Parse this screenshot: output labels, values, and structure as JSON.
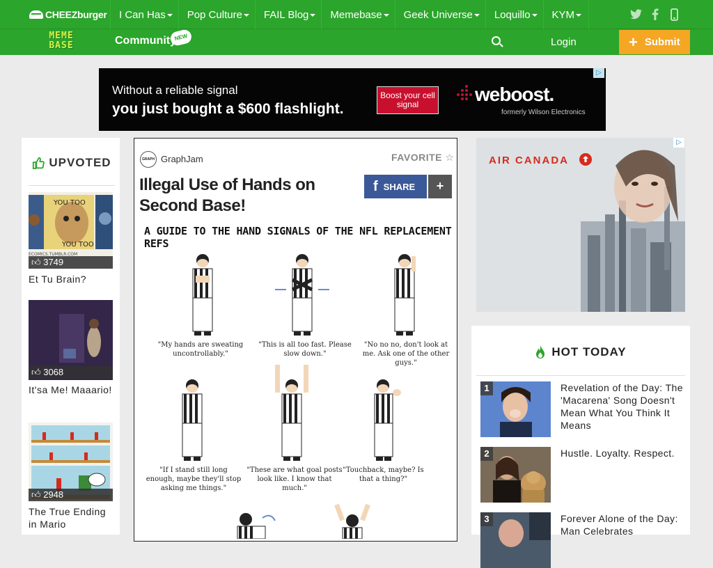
{
  "header": {
    "brand": "CHEEZburger",
    "nav": [
      {
        "label": "I Can Has"
      },
      {
        "label": "Pop Culture"
      },
      {
        "label": "FAIL Blog"
      },
      {
        "label": "Memebase"
      },
      {
        "label": "Geek Universe"
      },
      {
        "label": "Loquillo"
      },
      {
        "label": "KYM"
      }
    ],
    "social_icons": [
      "twitter-icon",
      "facebook-icon",
      "mobile-icon"
    ],
    "site_logo": "MEME BASE",
    "community_label": "Community",
    "new_badge": "NEW",
    "login_label": "Login",
    "submit_label": "Submit",
    "colors": {
      "brand_green": "#2ba52b",
      "submit_orange": "#f5a623"
    }
  },
  "top_ad": {
    "line1": "Without a reliable signal",
    "line2": "you just bought a $600 flashlight.",
    "cta": "Boost your cell signal",
    "brand": "weboost.",
    "formerly": "formerly Wilson Electronics"
  },
  "upvoted": {
    "title": "UPVOTED",
    "items": [
      {
        "count": "3749",
        "title": "Et Tu Brain?"
      },
      {
        "count": "3068",
        "title": "It'sa Me! Maaario!"
      },
      {
        "count": "2948",
        "title": "The True Ending in Mario"
      }
    ]
  },
  "post": {
    "author": "GraphJam",
    "favorite_label": "FAVORITE",
    "title": "Illegal Use of Hands on Second Base!",
    "share_label": "SHARE",
    "more_label": "+",
    "comic_title": "A GUIDE TO THE HAND SIGNALS OF THE NFL REPLACEMENT REFS",
    "captions": [
      "\"My hands are sweating uncontrollably.\"",
      "\"This is all too fast. Please slow down.\"",
      "\"No no no, don't look at me. Ask one of the other guys.\"",
      "\"If I stand still long enough, maybe they'll stop asking me things.\"",
      "\"These are what goal posts look like. I know that much.\"",
      "\"Touchback, maybe? Is that a thing?\""
    ]
  },
  "right_ad": {
    "brand": "AIR CANADA"
  },
  "hot_today": {
    "title": "HOT TODAY",
    "items": [
      {
        "rank": "1",
        "title": "Revelation of the Day: The 'Macarena' Song Doesn't Mean What You Think It Means"
      },
      {
        "rank": "2",
        "title": "Hustle. Loyalty. Respect."
      },
      {
        "rank": "3",
        "title": "Forever Alone of the Day: Man Celebrates"
      }
    ]
  }
}
